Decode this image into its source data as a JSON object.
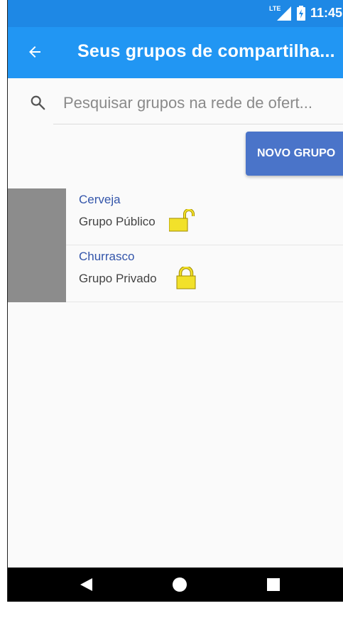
{
  "status_bar": {
    "network": "LTE",
    "time": "11:45"
  },
  "app_bar": {
    "title": "Seus grupos de compartilha..."
  },
  "search": {
    "placeholder": "Pesquisar grupos na rede de ofert..."
  },
  "new_group_button": {
    "label": "NOVO GRUPO"
  },
  "groups": [
    {
      "name": "Cerveja",
      "type": "Grupo Público",
      "lock_icon": "unlocked-padlock-icon"
    },
    {
      "name": "Churrasco",
      "type": "Grupo Privado",
      "lock_icon": "locked-padlock-icon"
    }
  ],
  "colors": {
    "status_bar": "#1e88e5",
    "app_bar": "#2196f3",
    "button": "#4a74c9",
    "group_name": "#3355aa",
    "lock": "#f2e12a"
  },
  "nav_icons": [
    "back-triangle-icon",
    "home-circle-icon",
    "recents-square-icon"
  ]
}
